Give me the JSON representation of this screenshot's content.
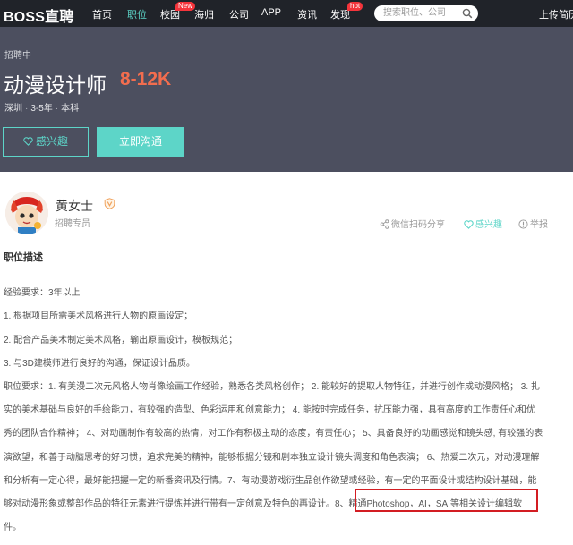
{
  "nav": {
    "logo": "BOSS直聘",
    "items": [
      "首页",
      "职位",
      "校园",
      "海归",
      "公司",
      "APP",
      "资讯",
      "发现"
    ],
    "campus_badge": "New",
    "discover_badge": "hot",
    "search_placeholder": "搜索职位、公司",
    "right_link": "上传简历"
  },
  "job": {
    "status": "招聘中",
    "title": "动漫设计师",
    "salary": "8-12K",
    "city": "深圳",
    "experience": "3-5年",
    "education": "本科",
    "interest_button": "感兴趣",
    "chat_button": "立即沟通"
  },
  "recruiter": {
    "name": "黄女士",
    "role": "招聘专员",
    "share": "微信扫码分享",
    "interest": "感兴趣",
    "report": "举报"
  },
  "description": {
    "title": "职位描述",
    "lines": [
      "经验要求：3年以上",
      "1. 根据项目所需美术风格进行人物的原画设定；",
      "2. 配合产品美术制定美术风格，输出原画设计，模板规范；",
      "3. 与3D建模师进行良好的沟通，保证设计品质。",
      "职位要求：1. 有美漫二次元风格人物肖像绘画工作经验，熟悉各类风格创作；  2. 能较好的提取人物特征，并进行创作成动漫风格；  3. 扎",
      "实的美术基础与良好的手绘能力，有较强的造型、色彩运用和创意能力；  4. 能按时完成任务，抗压能力强，具有高度的工作责任心和优",
      "秀的团队合作精神；  4、对动画制作有较高的热情，对工作有积极主动的态度，有责任心；  5、具备良好的动画感觉和镜头感, 有较强的表",
      "演欲望，和善于动脑思考的好习惯，追求完美的精神，能够根据分镜和剧本独立设计镜头调度和角色表演；  6、热爱二次元，对动漫理解",
      "和分析有一定心得，最好能把握一定的新番资讯及行情。7、有动漫游戏衍生品创作欲望或经验，有一定的平面设计或结构设计基础，能",
      "够对动漫形象或整部作品的特征元素进行提炼并进行带有一定创意及特色的再设计。8、精通Photoshop，AI，SAI等相关设计编辑软",
      "件。"
    ]
  },
  "colors": {
    "nav_bg": "#202329",
    "banner_bg": "#4c4f5f",
    "accent": "#5dd5c8",
    "salary": "#f26d4e",
    "highlight": "#d31d23"
  }
}
